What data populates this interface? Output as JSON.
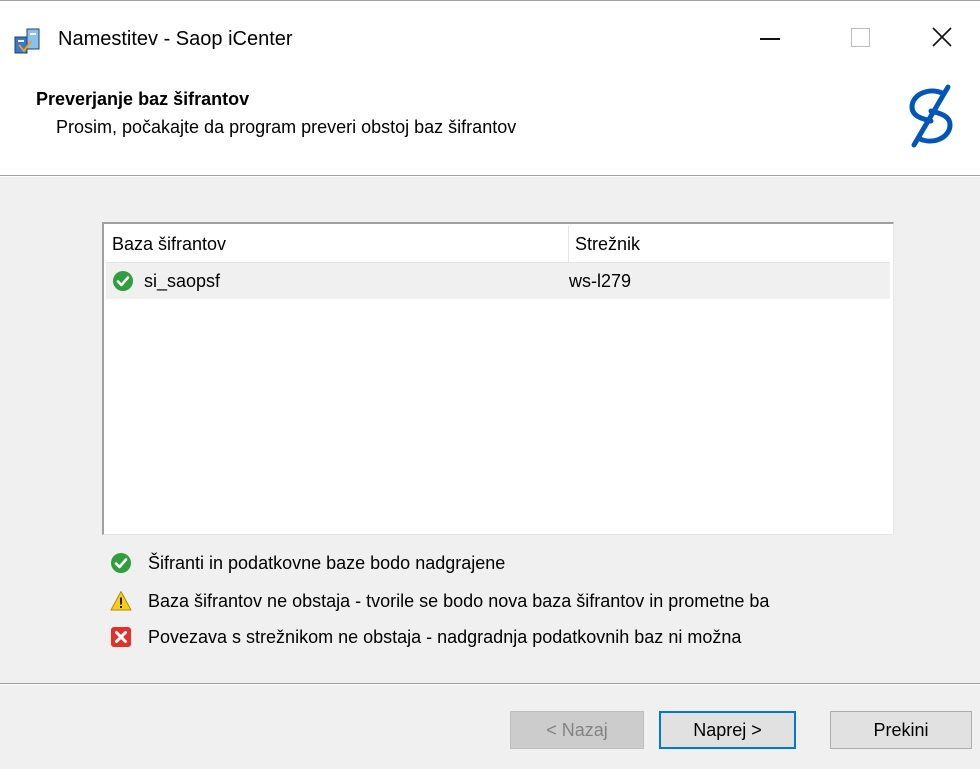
{
  "window": {
    "title": "Namestitev - Saop iCenter",
    "icons": {
      "app": "installer-package-icon",
      "minimize": "minimize-icon",
      "maximize": "maximize-icon",
      "close": "close-icon"
    }
  },
  "header": {
    "title": "Preverjanje baz šifrantov",
    "subtitle": "Prosim, počakajte da program preveri obstoj baz šifrantov",
    "logo_icon": "saop-logo-icon"
  },
  "table": {
    "columns": [
      "Baza šifrantov",
      "Strežnik"
    ],
    "rows": [
      {
        "status_icon": "check-icon",
        "database": "si_saopsf",
        "server": "ws-l279"
      }
    ]
  },
  "legend": [
    {
      "icon": "check-icon",
      "text": "Šifranti in podatkovne baze bodo nadgrajene"
    },
    {
      "icon": "warning-icon",
      "text": "Baza šifrantov ne obstaja - tvorile se bodo nova baza šifrantov in prometne ba"
    },
    {
      "icon": "error-icon",
      "text": "Povezava s strežnikom ne obstaja - nadgradnja podatkovnih baz ni možna"
    }
  ],
  "buttons": {
    "back": "< Nazaj",
    "next": "Naprej >",
    "cancel": "Prekini"
  },
  "colors": {
    "check": "#2e9e3e",
    "warning": "#f6cd1f",
    "error": "#e0312a",
    "logo": "#0055b8",
    "focus": "#0078d7"
  }
}
